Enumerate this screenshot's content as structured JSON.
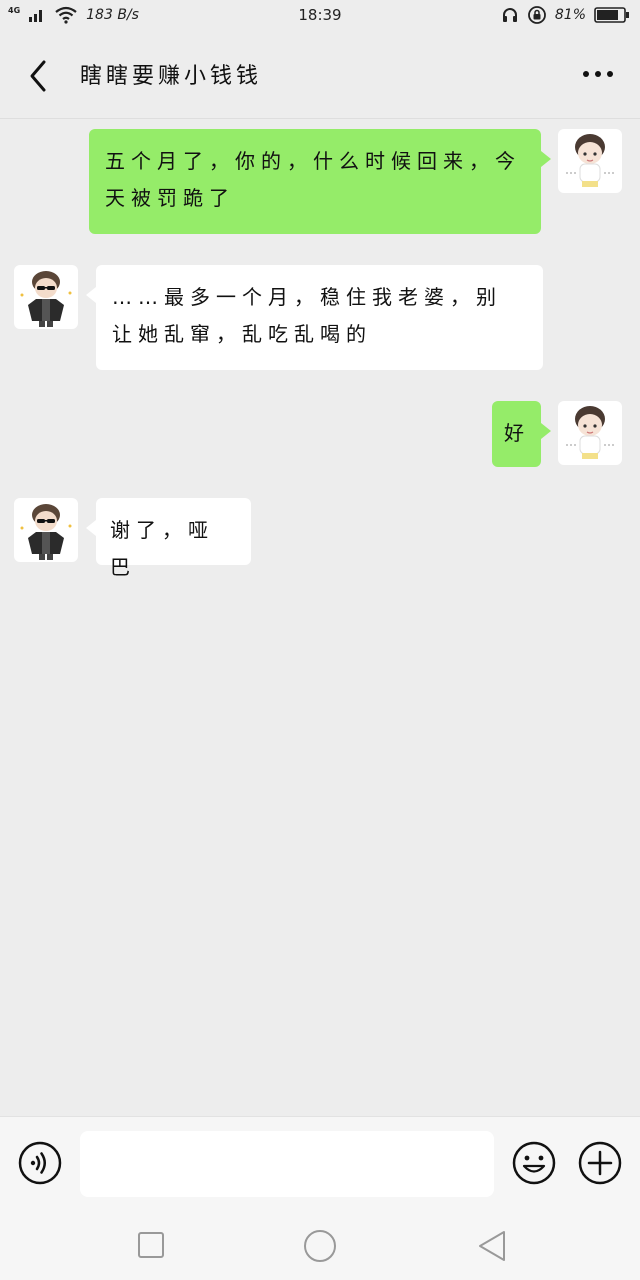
{
  "status_bar": {
    "network": "4G",
    "speed": "183 B/s",
    "time": "18:39",
    "battery": "81%",
    "icons": [
      "signal-icon",
      "wifi-icon",
      "headphones-icon",
      "rotation-lock-icon",
      "battery-icon"
    ]
  },
  "header": {
    "title": "瞎瞎要赚小钱钱",
    "back_icon": "chevron-left-icon",
    "more_icon": "more-dots-icon"
  },
  "messages": [
    {
      "side": "right",
      "text": "五个月了，你的，什么时候回来，今天被罚跪了"
    },
    {
      "side": "left",
      "text": "……最多一个月，稳住我老婆，别让她乱窜，乱吃乱喝的"
    },
    {
      "side": "right",
      "text": "好"
    },
    {
      "side": "left",
      "text": "谢了，哑巴"
    }
  ],
  "input_bar": {
    "placeholder": "",
    "value": "",
    "voice_icon": "voice-icon",
    "emoji_icon": "emoji-icon",
    "plus_icon": "plus-icon"
  },
  "nav_bar": {
    "icons": [
      "recent-apps-icon",
      "home-icon",
      "nav-back-icon"
    ]
  },
  "colors": {
    "background": "#ededed",
    "outgoing_bubble": "#95ec69",
    "incoming_bubble": "#ffffff"
  }
}
